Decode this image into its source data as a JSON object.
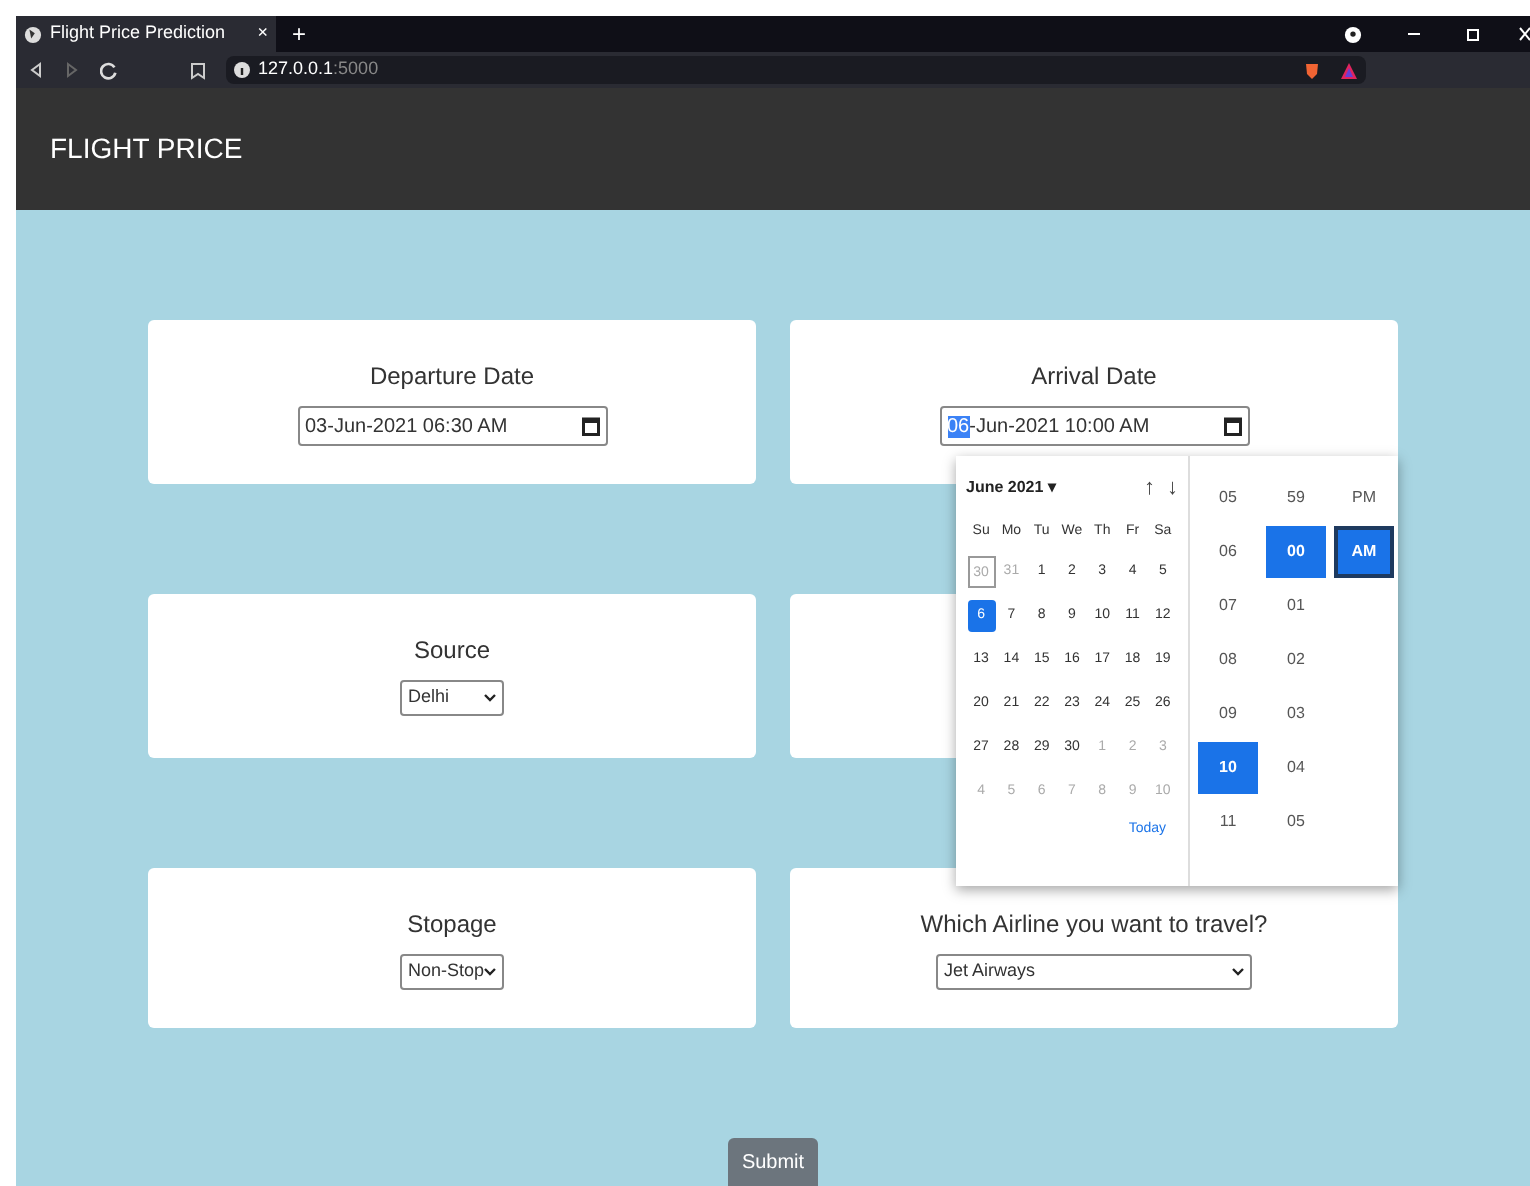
{
  "browser": {
    "tab_title": "Flight Price Prediction",
    "tab_close": "×",
    "new_tab": "+",
    "address_host": "127.0.0.1",
    "address_port": ":5000"
  },
  "navbar": {
    "brand": "FLIGHT PRICE"
  },
  "cards": [
    {
      "kind": "datetime",
      "label": "Departure Date",
      "segments": [
        {
          "text": "03-Jun-2021 06:30 AM",
          "selected": false
        }
      ]
    },
    {
      "kind": "datetime",
      "label": "Arrival Date",
      "segments": [
        {
          "text": "06",
          "selected": true
        },
        {
          "text": "-Jun-2021 10:00 AM",
          "selected": false
        }
      ]
    },
    {
      "kind": "select",
      "label": "Source",
      "value": "Delhi"
    },
    {
      "kind": "hidden"
    },
    {
      "kind": "select",
      "label": "Stopage",
      "value": "Non-Stop"
    },
    {
      "kind": "wide_select",
      "label": "Which Airline you want to travel?",
      "value": "Jet Airways"
    }
  ],
  "picker": {
    "month": "June 2021 ▾",
    "up": "↑",
    "down": "↓",
    "weekdays": [
      "Su",
      "Mo",
      "Tu",
      "We",
      "Th",
      "Fr",
      "Sa"
    ],
    "weeks": [
      [
        {
          "day": "30",
          "muted": true,
          "selected": false,
          "outlined": true
        },
        {
          "day": "31",
          "muted": true,
          "selected": false,
          "outlined": false
        },
        {
          "day": "1",
          "muted": false,
          "selected": false,
          "outlined": false
        },
        {
          "day": "2",
          "muted": false,
          "selected": false,
          "outlined": false
        },
        {
          "day": "3",
          "muted": false,
          "selected": false,
          "outlined": false
        },
        {
          "day": "4",
          "muted": false,
          "selected": false,
          "outlined": false
        },
        {
          "day": "5",
          "muted": false,
          "selected": false,
          "outlined": false
        }
      ],
      [
        {
          "day": "6",
          "muted": false,
          "selected": true,
          "outlined": false
        },
        {
          "day": "7",
          "muted": false,
          "selected": false,
          "outlined": false
        },
        {
          "day": "8",
          "muted": false,
          "selected": false,
          "outlined": false
        },
        {
          "day": "9",
          "muted": false,
          "selected": false,
          "outlined": false
        },
        {
          "day": "10",
          "muted": false,
          "selected": false,
          "outlined": false
        },
        {
          "day": "11",
          "muted": false,
          "selected": false,
          "outlined": false
        },
        {
          "day": "12",
          "muted": false,
          "selected": false,
          "outlined": false
        }
      ],
      [
        {
          "day": "13",
          "muted": false,
          "selected": false,
          "outlined": false
        },
        {
          "day": "14",
          "muted": false,
          "selected": false,
          "outlined": false
        },
        {
          "day": "15",
          "muted": false,
          "selected": false,
          "outlined": false
        },
        {
          "day": "16",
          "muted": false,
          "selected": false,
          "outlined": false
        },
        {
          "day": "17",
          "muted": false,
          "selected": false,
          "outlined": false
        },
        {
          "day": "18",
          "muted": false,
          "selected": false,
          "outlined": false
        },
        {
          "day": "19",
          "muted": false,
          "selected": false,
          "outlined": false
        }
      ],
      [
        {
          "day": "20",
          "muted": false,
          "selected": false,
          "outlined": false
        },
        {
          "day": "21",
          "muted": false,
          "selected": false,
          "outlined": false
        },
        {
          "day": "22",
          "muted": false,
          "selected": false,
          "outlined": false
        },
        {
          "day": "23",
          "muted": false,
          "selected": false,
          "outlined": false
        },
        {
          "day": "24",
          "muted": false,
          "selected": false,
          "outlined": false
        },
        {
          "day": "25",
          "muted": false,
          "selected": false,
          "outlined": false
        },
        {
          "day": "26",
          "muted": false,
          "selected": false,
          "outlined": false
        }
      ],
      [
        {
          "day": "27",
          "muted": false,
          "selected": false,
          "outlined": false
        },
        {
          "day": "28",
          "muted": false,
          "selected": false,
          "outlined": false
        },
        {
          "day": "29",
          "muted": false,
          "selected": false,
          "outlined": false
        },
        {
          "day": "30",
          "muted": false,
          "selected": false,
          "outlined": false
        },
        {
          "day": "1",
          "muted": true,
          "selected": false,
          "outlined": false
        },
        {
          "day": "2",
          "muted": true,
          "selected": false,
          "outlined": false
        },
        {
          "day": "3",
          "muted": true,
          "selected": false,
          "outlined": false
        }
      ],
      [
        {
          "day": "4",
          "muted": true,
          "selected": false,
          "outlined": false
        },
        {
          "day": "5",
          "muted": true,
          "selected": false,
          "outlined": false
        },
        {
          "day": "6",
          "muted": true,
          "selected": false,
          "outlined": false
        },
        {
          "day": "7",
          "muted": true,
          "selected": false,
          "outlined": false
        },
        {
          "day": "8",
          "muted": true,
          "selected": false,
          "outlined": false
        },
        {
          "day": "9",
          "muted": true,
          "selected": false,
          "outlined": false
        },
        {
          "day": "10",
          "muted": true,
          "selected": false,
          "outlined": false
        }
      ]
    ],
    "today": "Today",
    "hours": [
      {
        "text": "05",
        "selected": false
      },
      {
        "text": "06",
        "selected": false
      },
      {
        "text": "07",
        "selected": false
      },
      {
        "text": "08",
        "selected": false
      },
      {
        "text": "09",
        "selected": false
      },
      {
        "text": "10",
        "selected": true
      },
      {
        "text": "11",
        "selected": false
      }
    ],
    "minutes": [
      {
        "text": "59",
        "selected": false
      },
      {
        "text": "00",
        "selected": true
      },
      {
        "text": "01",
        "selected": false
      },
      {
        "text": "02",
        "selected": false
      },
      {
        "text": "03",
        "selected": false
      },
      {
        "text": "04",
        "selected": false
      },
      {
        "text": "05",
        "selected": false
      }
    ],
    "meridiem": [
      {
        "text": "PM",
        "selected": false
      },
      {
        "text": "AM",
        "selected": true
      }
    ]
  },
  "submit": "Submit"
}
